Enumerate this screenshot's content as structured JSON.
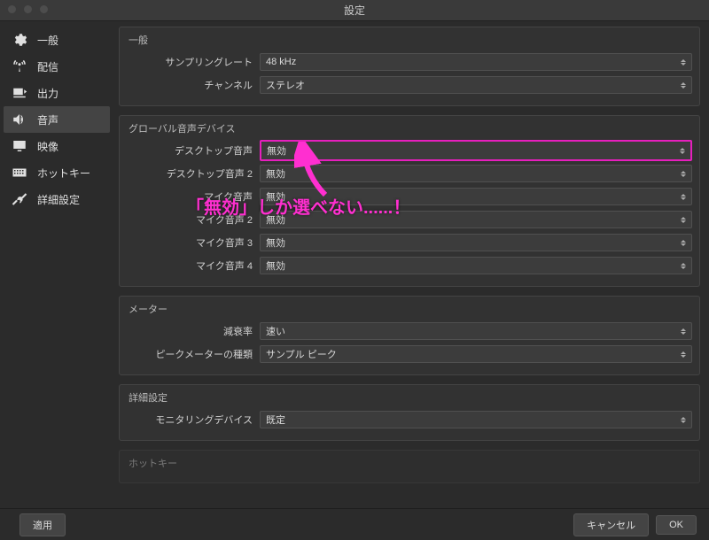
{
  "window": {
    "title": "設定"
  },
  "sidebar": {
    "items": [
      {
        "label": "一般"
      },
      {
        "label": "配信"
      },
      {
        "label": "出力"
      },
      {
        "label": "音声"
      },
      {
        "label": "映像"
      },
      {
        "label": "ホットキー"
      },
      {
        "label": "詳細設定"
      }
    ]
  },
  "sections": {
    "general": {
      "title": "一般",
      "rows": [
        {
          "label": "サンプリングレート",
          "value": "48 kHz"
        },
        {
          "label": "チャンネル",
          "value": "ステレオ"
        }
      ]
    },
    "global_audio": {
      "title": "グローバル音声デバイス",
      "rows": [
        {
          "label": "デスクトップ音声",
          "value": "無効"
        },
        {
          "label": "デスクトップ音声 2",
          "value": "無効"
        },
        {
          "label": "マイク音声",
          "value": "無効"
        },
        {
          "label": "マイク音声 2",
          "value": "無効"
        },
        {
          "label": "マイク音声 3",
          "value": "無効"
        },
        {
          "label": "マイク音声 4",
          "value": "無効"
        }
      ]
    },
    "meter": {
      "title": "メーター",
      "rows": [
        {
          "label": "減衰率",
          "value": "速い"
        },
        {
          "label": "ピークメーターの種類",
          "value": "サンプル ピーク"
        }
      ]
    },
    "advanced": {
      "title": "詳細設定",
      "rows": [
        {
          "label": "モニタリングデバイス",
          "value": "既定"
        }
      ]
    },
    "hotkey": {
      "title": "ホットキー"
    }
  },
  "footer": {
    "apply": "適用",
    "cancel": "キャンセル",
    "ok": "OK"
  },
  "annotation": {
    "text": "「無効」しか選べない......！"
  }
}
